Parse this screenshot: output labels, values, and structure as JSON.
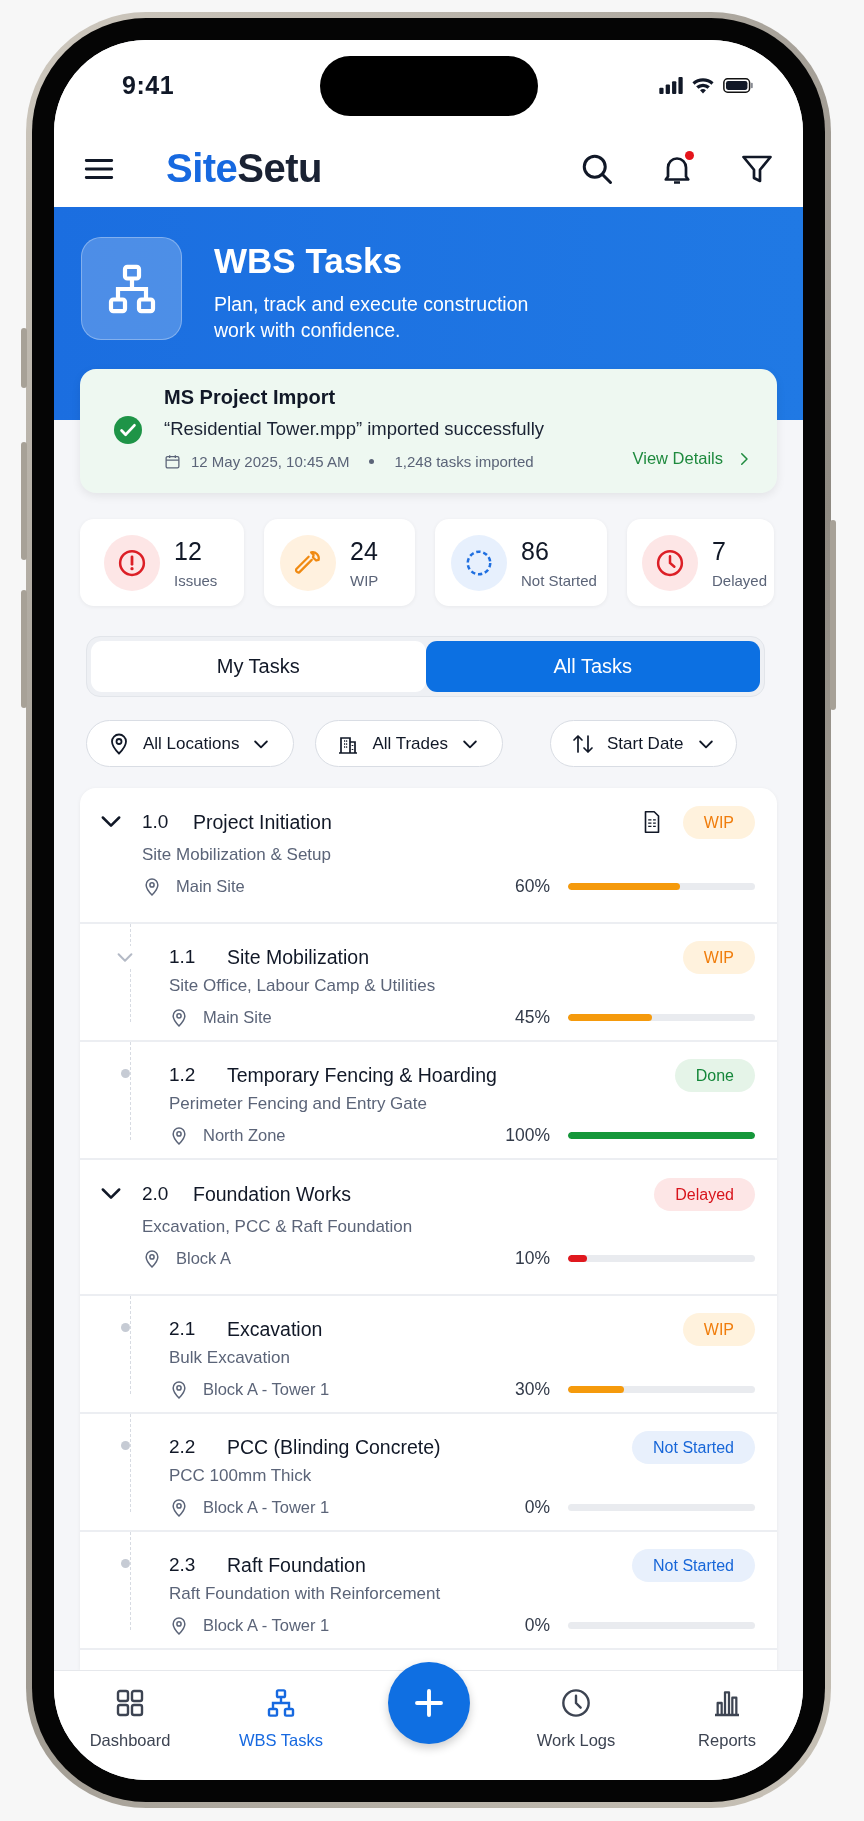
{
  "status_bar": {
    "time": "9:41"
  },
  "header": {
    "logo": {
      "accent": "Site",
      "rest": "Setu"
    },
    "notification_dot": true
  },
  "banner": {
    "title": "WBS Tasks",
    "subtitle": "Plan, track and execute construction work with confidence."
  },
  "import_notice": {
    "title": "MS Project Import",
    "message": "“Residential Tower.mpp” imported successfully",
    "date": "12 May 2025, 10:45 AM",
    "count": "1,248 tasks imported",
    "link": "View Details"
  },
  "stats": [
    {
      "kind": "issues",
      "value": "12",
      "label": "Issues"
    },
    {
      "kind": "wip",
      "value": "24",
      "label": "WIP"
    },
    {
      "kind": "not_started",
      "value": "86",
      "label": "Not Started"
    },
    {
      "kind": "delayed",
      "value": "7",
      "label": "Delayed"
    }
  ],
  "tabs": [
    {
      "label": "My Tasks",
      "selected": false
    },
    {
      "label": "All Tasks",
      "selected": true
    }
  ],
  "filters": [
    {
      "kind": "location",
      "label": "All Locations"
    },
    {
      "kind": "trade",
      "label": "All Trades"
    },
    {
      "kind": "sort",
      "label": "Start Date"
    }
  ],
  "tasks": [
    {
      "code": "1.0",
      "title": "Project Initiation",
      "subtitle": "Site Mobilization & Setup",
      "location": "Main Site",
      "percent": "60%",
      "level": 0.6,
      "status": {
        "kind": "wip",
        "label": "WIP"
      },
      "expanded": true,
      "has_document": true,
      "children": [
        {
          "code": "1.1",
          "title": "Site Mobilization",
          "subtitle": "Site Office, Labour Camp & Utilities",
          "location": "Main Site",
          "percent": "45%",
          "level": 0.45,
          "status": {
            "kind": "wip",
            "label": "WIP"
          },
          "expanded": true
        },
        {
          "code": "1.2",
          "title": "Temporary Fencing & Hoarding",
          "subtitle": "Perimeter Fencing and Entry Gate",
          "location": "North Zone",
          "percent": "100%",
          "level": 1,
          "status": {
            "kind": "done",
            "label": "Done"
          }
        }
      ]
    },
    {
      "code": "2.0",
      "title": "Foundation Works",
      "subtitle": "Excavation, PCC & Raft Foundation",
      "location": "Block A",
      "percent": "10%",
      "level": 0.1,
      "status": {
        "kind": "delayed",
        "label": "Delayed"
      },
      "expanded": true,
      "children": [
        {
          "code": "2.1",
          "title": "Excavation",
          "subtitle": "Bulk Excavation",
          "location": "Block A - Tower 1",
          "percent": "30%",
          "level": 0.3,
          "status": {
            "kind": "wip",
            "label": "WIP"
          }
        },
        {
          "code": "2.2",
          "title": "PCC (Blinding Concrete)",
          "subtitle": "PCC 100mm Thick",
          "location": "Block A - Tower 1",
          "percent": "0%",
          "level": 0,
          "status": {
            "kind": "not_started",
            "label": "Not Started"
          }
        },
        {
          "code": "2.3",
          "title": "Raft Foundation",
          "subtitle": "Raft Foundation with Reinforcement",
          "location": "Block A - Tower 1",
          "percent": "0%",
          "level": 0,
          "status": {
            "kind": "not_started",
            "label": "Not Started"
          }
        }
      ]
    }
  ],
  "bottom_nav": [
    {
      "kind": "dashboard",
      "label": "Dashboard",
      "selected": false
    },
    {
      "kind": "wbs",
      "label": "WBS Tasks",
      "selected": true
    },
    {
      "kind": "add"
    },
    {
      "kind": "logs",
      "label": "Work Logs",
      "selected": false
    },
    {
      "kind": "reports",
      "label": "Reports",
      "selected": false
    }
  ]
}
